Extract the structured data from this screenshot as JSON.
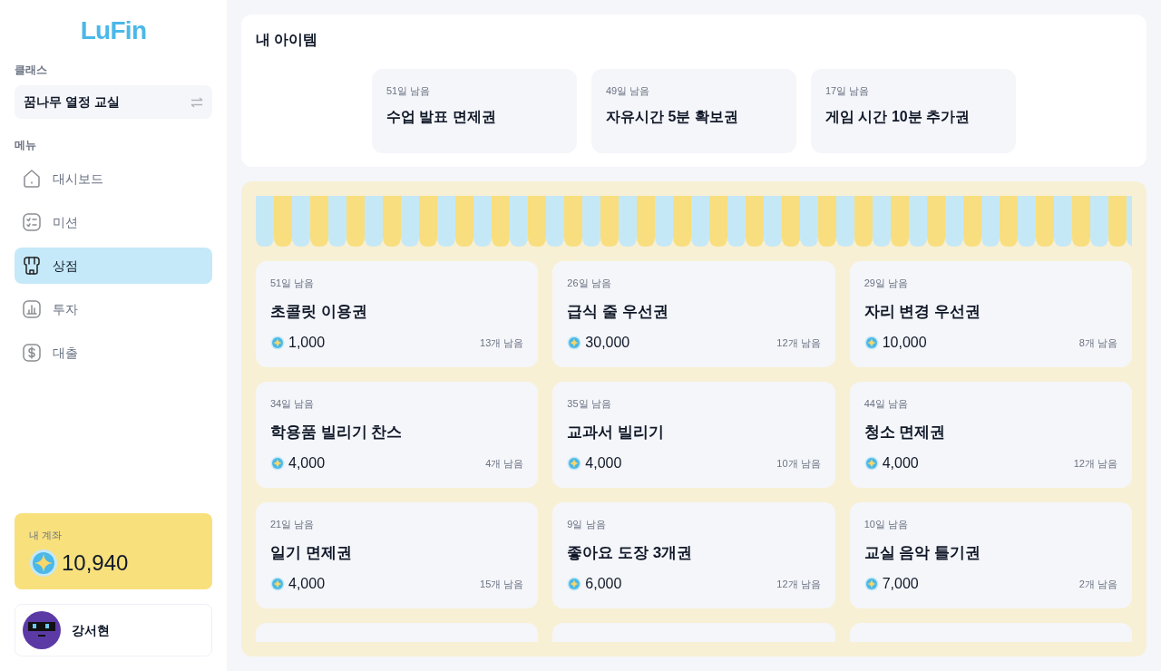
{
  "logo": "LuFin",
  "class_section": {
    "label": "클래스",
    "current": "꿈나무 열정 교실"
  },
  "menu": {
    "label": "메뉴",
    "items": [
      {
        "label": "대시보드",
        "kind": "home",
        "selected": false
      },
      {
        "label": "미션",
        "kind": "checklist",
        "selected": false
      },
      {
        "label": "상점",
        "kind": "store",
        "selected": true
      },
      {
        "label": "투자",
        "kind": "chart",
        "selected": false
      },
      {
        "label": "대출",
        "kind": "dollar",
        "selected": false
      }
    ]
  },
  "account": {
    "label": "내 계좌",
    "balance": "10,940"
  },
  "user": {
    "name": "강서현"
  },
  "my_items": {
    "title": "내 아이템",
    "items": [
      {
        "remaining": "51일 남음",
        "name": "수업 발표 면제권"
      },
      {
        "remaining": "49일 남음",
        "name": "자유시간 5분 확보권"
      },
      {
        "remaining": "17일 남음",
        "name": "게임 시간 10분 추가권"
      }
    ]
  },
  "shop": {
    "items": [
      {
        "remaining": "51일 남음",
        "name": "초콜릿 이용권",
        "price": "1,000",
        "stock": "13개 남음"
      },
      {
        "remaining": "26일 남음",
        "name": "급식 줄 우선권",
        "price": "30,000",
        "stock": "12개 남음"
      },
      {
        "remaining": "29일 남음",
        "name": "자리 변경 우선권",
        "price": "10,000",
        "stock": "8개 남음"
      },
      {
        "remaining": "34일 남음",
        "name": "학용품 빌리기 찬스",
        "price": "4,000",
        "stock": "4개 남음"
      },
      {
        "remaining": "35일 남음",
        "name": "교과서 빌리기",
        "price": "4,000",
        "stock": "10개 남음"
      },
      {
        "remaining": "44일 남음",
        "name": "청소 면제권",
        "price": "4,000",
        "stock": "12개 남음"
      },
      {
        "remaining": "21일 남음",
        "name": "일기 면제권",
        "price": "4,000",
        "stock": "15개 남음"
      },
      {
        "remaining": "9일 남음",
        "name": "좋아요 도장 3개권",
        "price": "6,000",
        "stock": "12개 남음"
      },
      {
        "remaining": "10일 남음",
        "name": "교실 음악 틀기권",
        "price": "7,000",
        "stock": "2개 남음"
      }
    ],
    "cut_off_cards": [
      {
        "kind": "card"
      },
      {
        "kind": "card"
      },
      {
        "kind": "card"
      }
    ]
  }
}
